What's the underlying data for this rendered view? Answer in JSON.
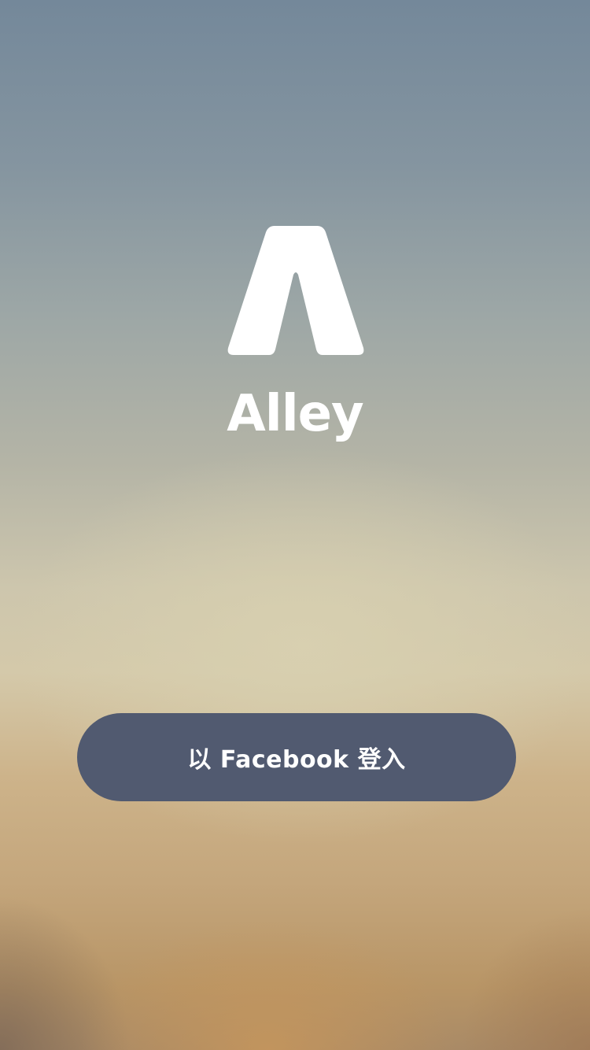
{
  "app": {
    "name": "Alley",
    "logo_icon": "alley-a-logo-icon"
  },
  "login": {
    "facebook_button_label": "以 Facebook 登入"
  },
  "colors": {
    "button_background": "#515a70",
    "text": "#ffffff"
  }
}
